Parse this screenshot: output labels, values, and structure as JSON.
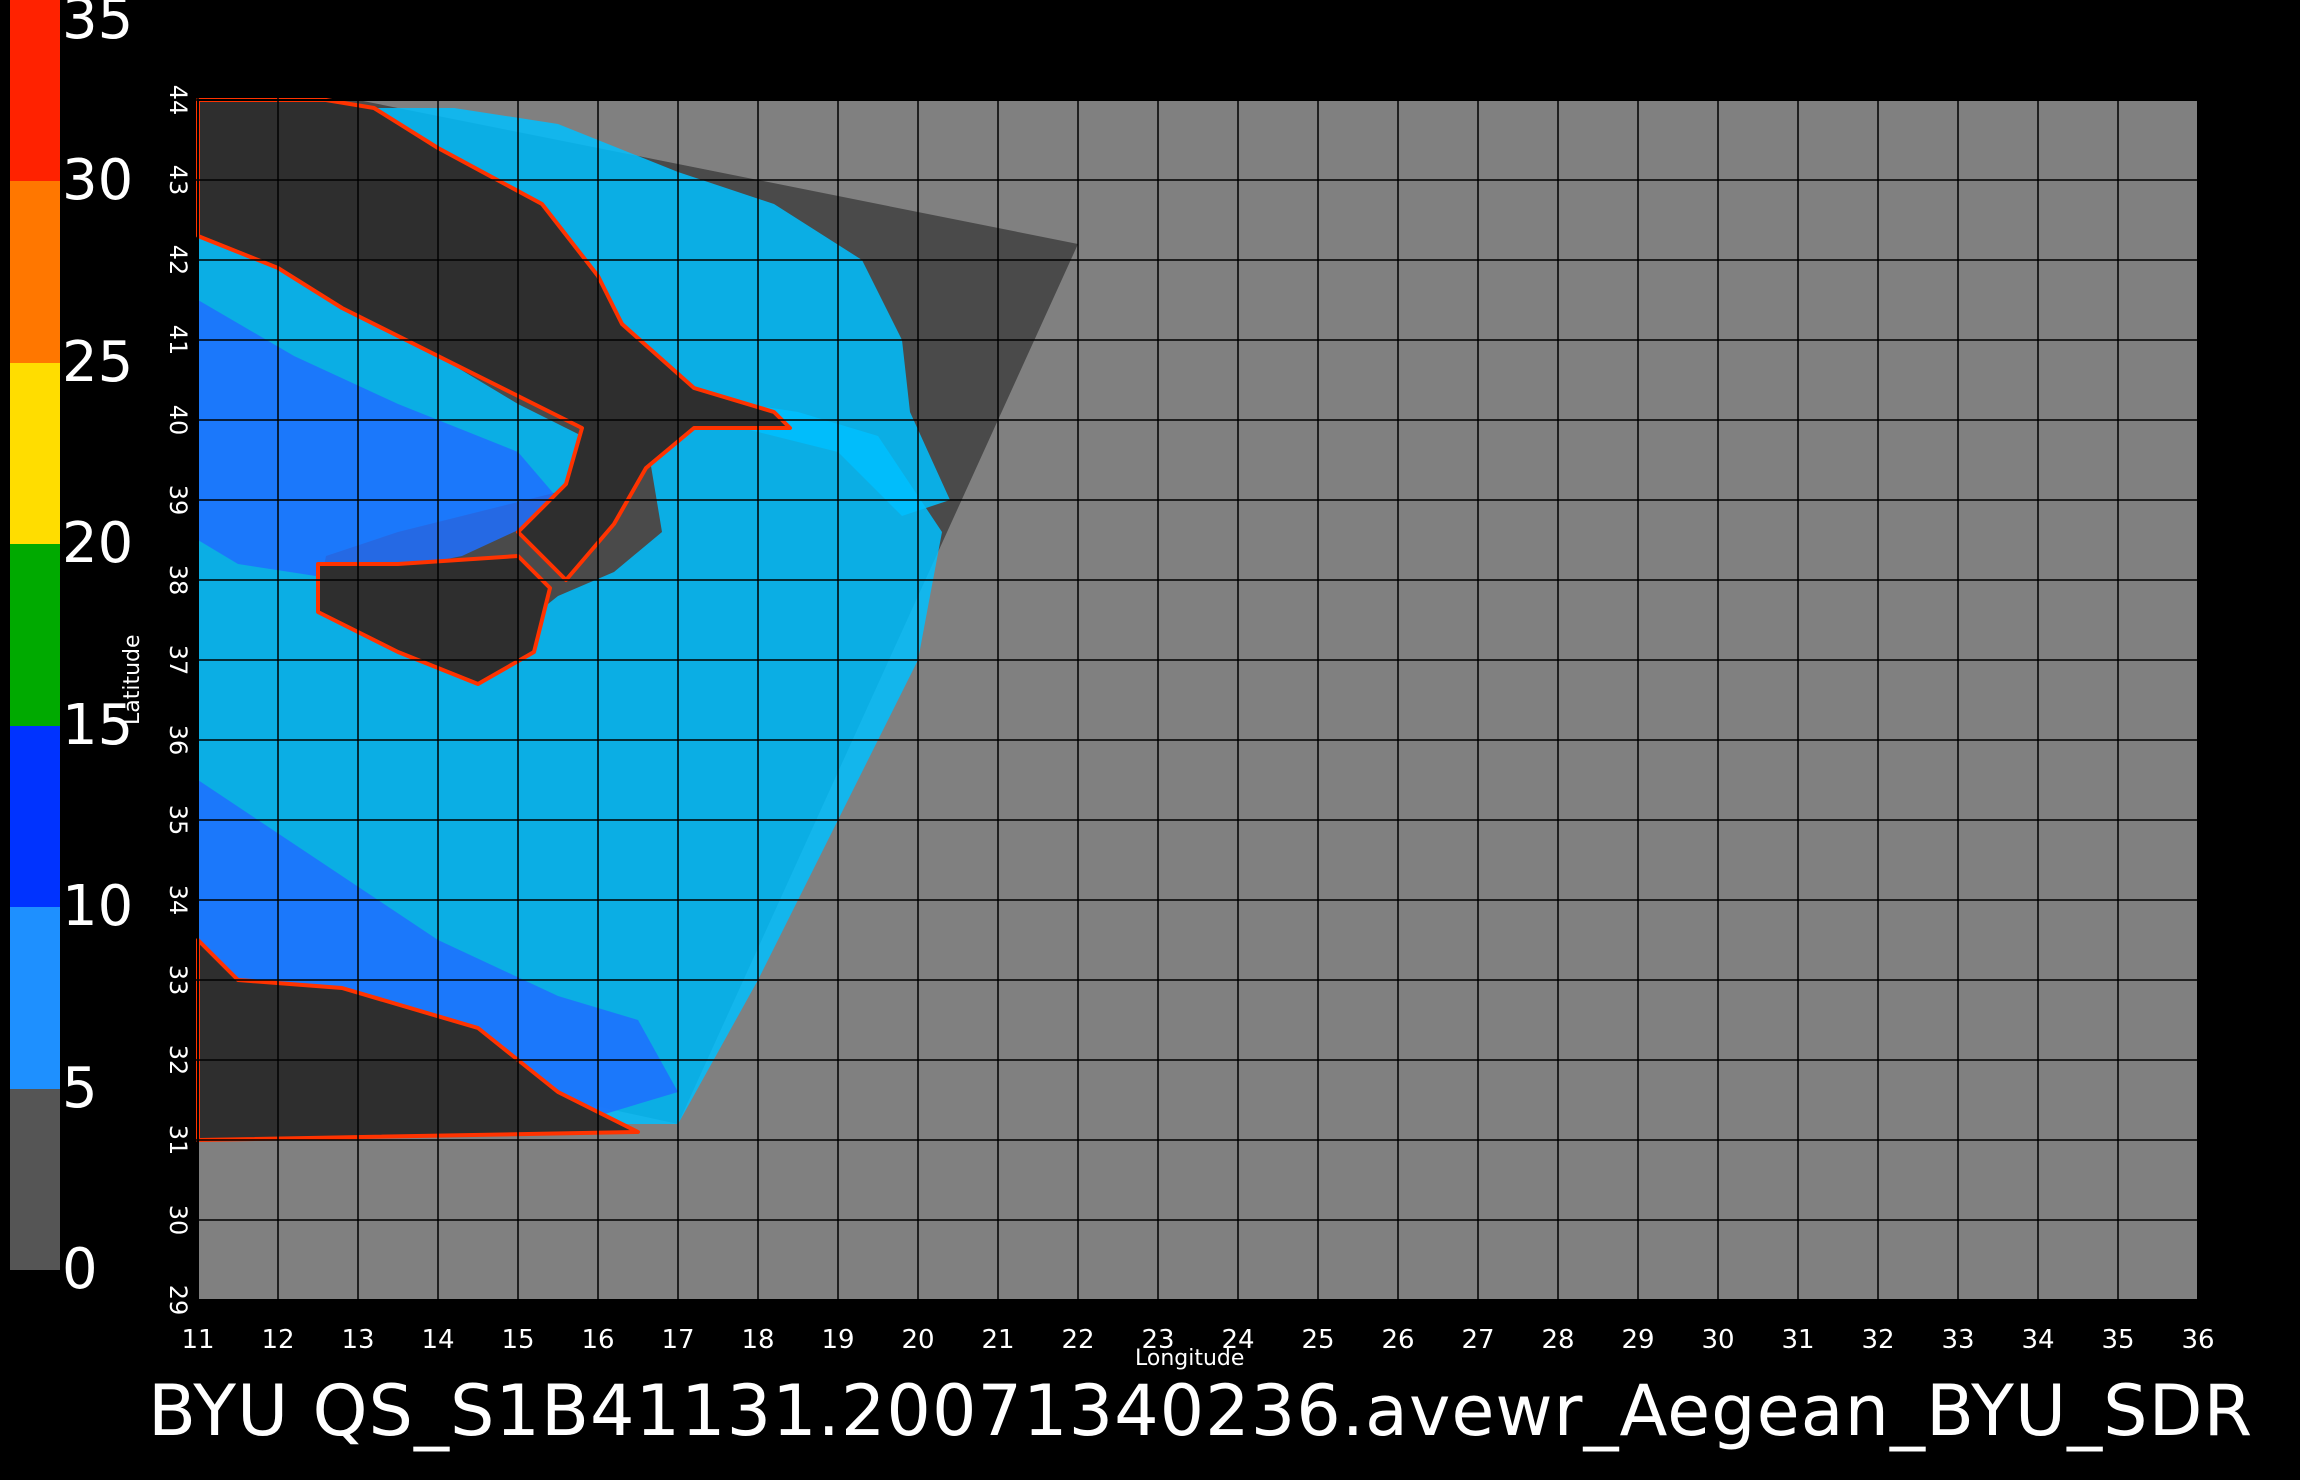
{
  "colorbar": {
    "ticks": [
      "35",
      "30",
      "25",
      "20",
      "15",
      "10",
      "5",
      "0"
    ],
    "range": [
      0,
      35
    ],
    "stops": [
      {
        "from": 0,
        "to": 5,
        "color": "#555555"
      },
      {
        "from": 5,
        "to": 10,
        "color": "#1e90ff"
      },
      {
        "from": 10,
        "to": 15,
        "color": "#0033ff"
      },
      {
        "from": 15,
        "to": 20,
        "color": "#00aa00"
      },
      {
        "from": 20,
        "to": 25,
        "color": "#ffdd00"
      },
      {
        "from": 25,
        "to": 30,
        "color": "#ff7700"
      },
      {
        "from": 30,
        "to": 35,
        "color": "#ff2200"
      }
    ]
  },
  "axes": {
    "longitude_label": "Longitude",
    "latitude_label": "Latitude",
    "lon_ticks": [
      "11",
      "12",
      "13",
      "14",
      "15",
      "16",
      "17",
      "18",
      "19",
      "20",
      "21",
      "22",
      "23",
      "24",
      "25",
      "26",
      "27",
      "28",
      "29",
      "30",
      "31",
      "32",
      "33",
      "34",
      "35",
      "36"
    ],
    "lat_ticks": [
      "29",
      "30",
      "31",
      "32",
      "33",
      "34",
      "35",
      "36",
      "37",
      "38",
      "39",
      "40",
      "41",
      "42",
      "43",
      "44"
    ]
  },
  "title": "BYU  QS_S1B41131.20071340236.avewr_Aegean_BYU_SDR",
  "colors": {
    "background": "#000000",
    "map_fill": "#808080",
    "swath_fill": "#4a4a4a",
    "wind_low": "#00bfff",
    "wind_mid": "#1e6fff"
  }
}
